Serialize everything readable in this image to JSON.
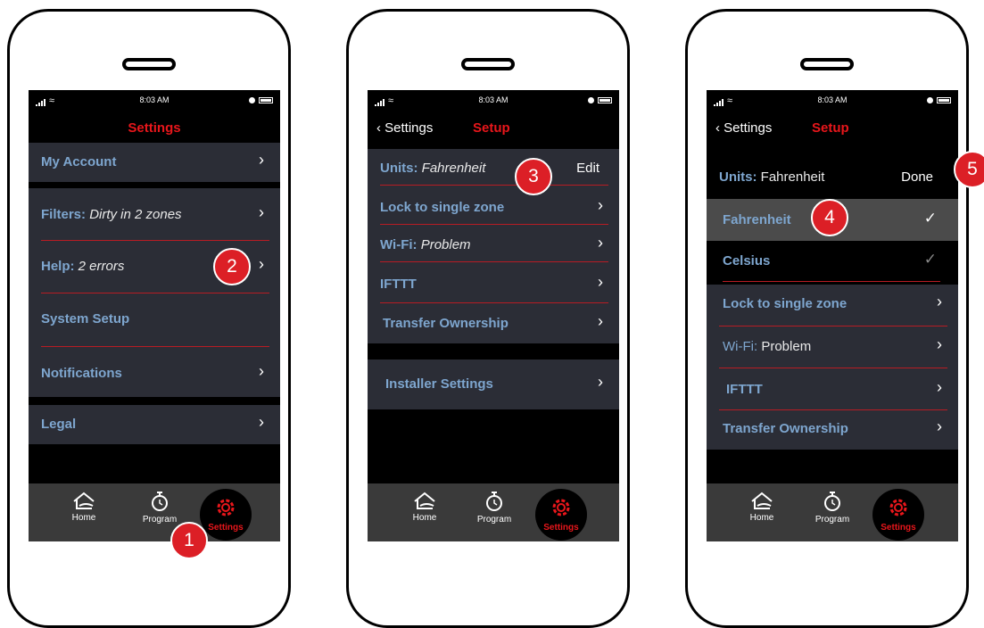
{
  "status": {
    "time": "8:03 AM"
  },
  "tabbar": {
    "home": "Home",
    "program": "Program",
    "settings": "Settings"
  },
  "screen1": {
    "title": "Settings",
    "rows": [
      {
        "label": "My Account"
      },
      {
        "label": "Filters:",
        "value": "Dirty in 2 zones"
      },
      {
        "label": "Help:",
        "value": "2 errors"
      },
      {
        "label": "System Setup"
      },
      {
        "label": "Notifications"
      },
      {
        "label": "Legal"
      }
    ],
    "badges": [
      "1",
      "2"
    ]
  },
  "screen2": {
    "back": "Settings",
    "title": "Setup",
    "units_label": "Units:",
    "units_value": "Fahrenheit",
    "edit": "Edit",
    "rows": [
      {
        "label": "Lock to single zone"
      },
      {
        "label": "Wi-Fi:",
        "value": "Problem"
      },
      {
        "label": "IFTTT"
      },
      {
        "label": "Transfer Ownership"
      }
    ],
    "installer": "Installer Settings",
    "badge": "3"
  },
  "screen3": {
    "back": "Settings",
    "title": "Setup",
    "units_label": "Units:",
    "units_value": "Fahrenheit",
    "done": "Done",
    "options": [
      {
        "label": "Fahrenheit"
      },
      {
        "label": "Celsius"
      }
    ],
    "rows": [
      {
        "label": "Lock to single zone"
      },
      {
        "label": "Wi-Fi:",
        "value": "Problem"
      },
      {
        "label": "IFTTT"
      },
      {
        "label": "Transfer Ownership"
      }
    ],
    "badges": [
      "4",
      "5"
    ]
  }
}
